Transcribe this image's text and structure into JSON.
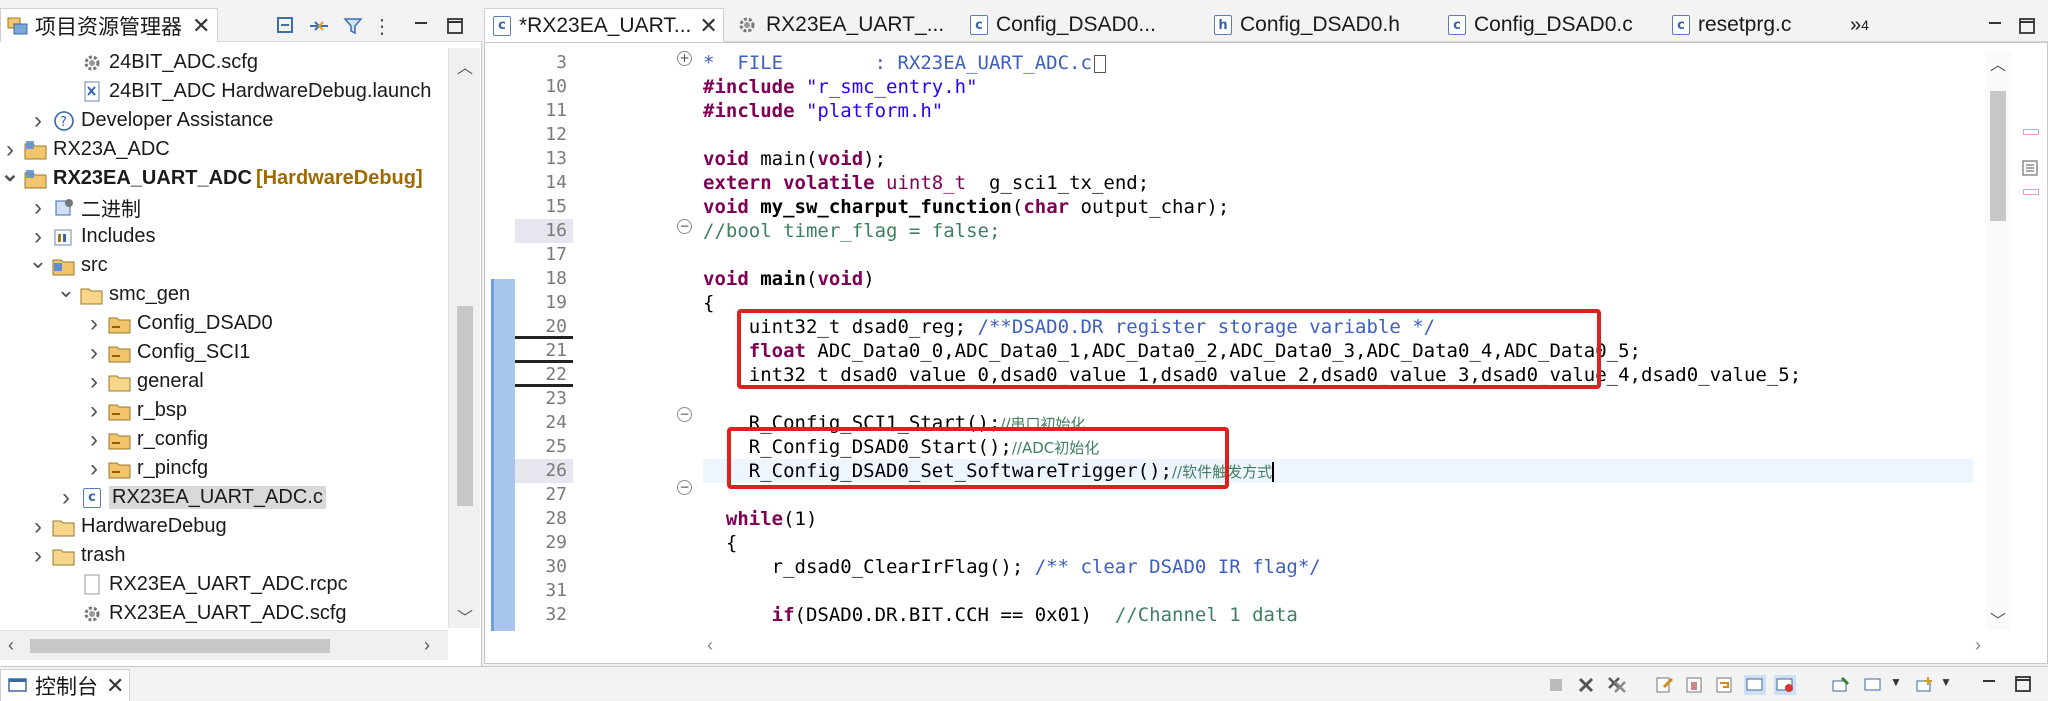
{
  "explorer": {
    "tab_label": "项目资源管理器",
    "tree": [
      {
        "label": "24BIT_ADC.scfg",
        "icon": "gear-file-icon",
        "arrow": ""
      },
      {
        "label": "24BIT_ADC HardwareDebug.launch",
        "icon": "launch-file-icon",
        "arrow": ""
      },
      {
        "label": "Developer Assistance",
        "icon": "help-icon",
        "arrow": ">"
      },
      {
        "label": "RX23A_ADC",
        "icon": "project-folder-icon",
        "arrow": ">"
      },
      {
        "label": "RX23EA_UART_ADC",
        "decoration": "[HardwareDebug]",
        "icon": "project-folder-icon",
        "arrow": "v",
        "bold": true
      },
      {
        "label": "二进制",
        "icon": "binaries-icon",
        "arrow": ">"
      },
      {
        "label": "Includes",
        "icon": "includes-icon",
        "arrow": ">"
      },
      {
        "label": "src",
        "icon": "source-folder-icon",
        "arrow": "v"
      },
      {
        "label": "smc_gen",
        "icon": "folder-icon",
        "arrow": "v"
      },
      {
        "label": "Config_DSAD0",
        "icon": "package-folder-icon",
        "arrow": ">"
      },
      {
        "label": "Config_SCI1",
        "icon": "package-folder-icon",
        "arrow": ">"
      },
      {
        "label": "general",
        "icon": "folder-icon",
        "arrow": ">"
      },
      {
        "label": "r_bsp",
        "icon": "package-folder-icon",
        "arrow": ">"
      },
      {
        "label": "r_config",
        "icon": "package-folder-icon",
        "arrow": ">"
      },
      {
        "label": "r_pincfg",
        "icon": "package-folder-icon",
        "arrow": ">"
      },
      {
        "label": "RX23EA_UART_ADC.c",
        "icon": "c-file-icon",
        "arrow": ">",
        "selected": true
      },
      {
        "label": "HardwareDebug",
        "icon": "folder-icon",
        "arrow": ">"
      },
      {
        "label": "trash",
        "icon": "folder-icon",
        "arrow": ">"
      },
      {
        "label": "RX23EA_UART_ADC.rcpc",
        "icon": "file-icon",
        "arrow": ""
      },
      {
        "label": "RX23EA_UART_ADC.scfg",
        "icon": "gear-file-icon",
        "arrow": ""
      }
    ]
  },
  "editor": {
    "tabs": [
      {
        "label": "*RX23EA_UART...",
        "icon": "c-file-icon",
        "active": true,
        "closable": true
      },
      {
        "label": "RX23EA_UART_...",
        "icon": "gear-file-icon"
      },
      {
        "label": "Config_DSAD0...",
        "icon": "c-file-icon"
      },
      {
        "label": "Config_DSAD0.h",
        "icon": "h-file-icon"
      },
      {
        "label": "Config_DSAD0.c",
        "icon": "c-file-icon"
      },
      {
        "label": "resetprg.c",
        "icon": "c-file-icon"
      }
    ],
    "overflow_label": "»",
    "overflow_count": "4",
    "line_numbers": [
      "3",
      "10",
      "11",
      "12",
      "13",
      "14",
      "15",
      "16",
      "17",
      "18",
      "19",
      "20",
      "21",
      "22",
      "23",
      "24",
      "25",
      "26",
      "27",
      "28",
      "29",
      "30",
      "31",
      "32"
    ],
    "code": {
      "l3_comment": "*  FILE        : RX23EA_UART_ADC.c",
      "l10_include": "#include",
      "l10_file": "\"r_smc_entry.h\"",
      "l11_include": "#include",
      "l11_file": "\"platform.h\"",
      "l13_kw": "void",
      "l13_rest": " main(",
      "l13_kw2": "void",
      "l13_end": ");",
      "l14_kw": "extern volatile",
      "l14_ty": "uint8_t",
      "l14_rest": "  g_sci1_tx_end;",
      "l15_kw": "void",
      "l15_fn": "my_sw_charput_function",
      "l15_open": "(",
      "l15_kw2": "char",
      "l15_rest": " output_char);",
      "l16_comment": "//bool timer_flag = false;",
      "l18_kw": "void",
      "l18_fn": "main",
      "l18_open": "(",
      "l18_kw2": "void",
      "l18_close": ")",
      "l19": "{",
      "l20_code": "    uint32_t dsad0_reg; ",
      "l20_doc": "/**DSAD0.DR register storage variable */",
      "l21_kw": "    float",
      "l21_rest": " ADC_Data0_0,ADC_Data0_1,ADC_Data0_2,ADC_Data0_3,ADC_Data0_4,ADC_Data0_5;",
      "l22": "    int32_t dsad0_value_0,dsad0_value_1,dsad0_value_2,dsad0_value_3,dsad0_value_4,dsad0_value_5;",
      "l24_code": "    R_Config_SCI1_Start();",
      "l24_comment": "//串口初始化",
      "l25_code": "    R_Config_DSAD0_Start();",
      "l25_comment": "//ADC初始化",
      "l26_code": "    R_Config_DSAD0_Set_SoftwareTrigger();",
      "l26_comment": "//软件触发方式",
      "l28_kw": "  while",
      "l28_rest": "(1)",
      "l29": "  {",
      "l30_code": "      r_dsad0_ClearIrFlag(); ",
      "l30_doc": "/** clear DSAD0 IR flag*/",
      "l32_kw": "      if",
      "l32_code": "(DSAD0.DR.BIT.CCH == 0x01)  ",
      "l32_comment": "//Channel 1 data"
    }
  },
  "console": {
    "tab_label": "控制台"
  },
  "colors": {
    "keyword": "#7f0055",
    "string": "#2a00ff",
    "comment": "#3f7f5f",
    "doc_comment": "#3f5fbf",
    "highlight_box": "#e0201c"
  }
}
